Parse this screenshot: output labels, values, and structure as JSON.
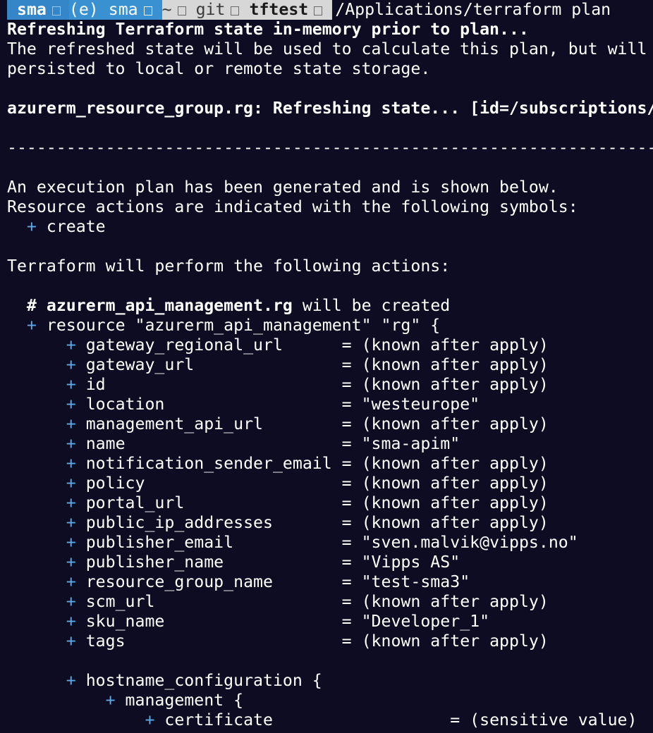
{
  "prompt": {
    "user": "sma",
    "env": "(e) sma",
    "home": "~",
    "git": "git",
    "branch": "tftest",
    "command": "/Applications/terraform plan"
  },
  "output": {
    "refreshing": "Refreshing Terraform state in-memory prior to plan...",
    "refreshed_1": "The refreshed state will be used to calculate this plan, but will not be",
    "refreshed_2": "persisted to local or remote state storage.",
    "rg_refresh": "azurerm_resource_group.rg: Refreshing state... [id=/subscriptions/",
    "separator": "------------------------------------------------------------------------",
    "plan_generated": "An execution plan has been generated and is shown below.",
    "symbols_intro": "Resource actions are indicated with the following symbols:",
    "symbol_plus": "+",
    "symbol_create": "create",
    "will_perform": "Terraform will perform the following actions:",
    "comment_hash": "#",
    "resource_addr": "azurerm_api_management.rg",
    "will_be_created": "will be created",
    "resource_decl": "resource \"azurerm_api_management\" \"rg\" {",
    "attributes": [
      {
        "name": "gateway_regional_url      ",
        "value": "= (known after apply)"
      },
      {
        "name": "gateway_url               ",
        "value": "= (known after apply)"
      },
      {
        "name": "id                        ",
        "value": "= (known after apply)"
      },
      {
        "name": "location                  ",
        "value": "= \"westeurope\""
      },
      {
        "name": "management_api_url        ",
        "value": "= (known after apply)"
      },
      {
        "name": "name                      ",
        "value": "= \"sma-apim\""
      },
      {
        "name": "notification_sender_email ",
        "value": "= (known after apply)"
      },
      {
        "name": "policy                    ",
        "value": "= (known after apply)"
      },
      {
        "name": "portal_url                ",
        "value": "= (known after apply)"
      },
      {
        "name": "public_ip_addresses       ",
        "value": "= (known after apply)"
      },
      {
        "name": "publisher_email           ",
        "value": "= \"sven.malvik@vipps.no\""
      },
      {
        "name": "publisher_name            ",
        "value": "= \"Vipps AS\""
      },
      {
        "name": "resource_group_name       ",
        "value": "= \"test-sma3\""
      },
      {
        "name": "scm_url                   ",
        "value": "= (known after apply)"
      },
      {
        "name": "sku_name                  ",
        "value": "= \"Developer_1\""
      },
      {
        "name": "tags                      ",
        "value": "= (known after apply)"
      }
    ],
    "hostname_config": "hostname_configuration {",
    "management": "management {",
    "certificate": "certificate                  ",
    "certificate_value": "= (sensitive value)"
  }
}
